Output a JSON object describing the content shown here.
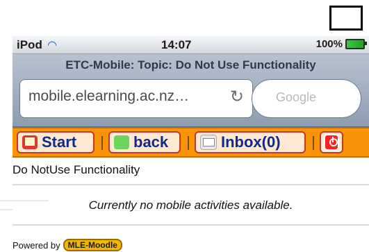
{
  "status_bar": {
    "carrier": "iPod",
    "time": "14:07",
    "battery": "100%"
  },
  "browser": {
    "title": "ETC-Mobile: Topic: Do Not Use Functionality",
    "url": "mobile.elearning.ac.nz…",
    "search_placeholder": "Google"
  },
  "nav": {
    "start_label": "Start",
    "back_label": "back",
    "inbox_label": "Inbox(0)"
  },
  "content": {
    "heading": "Do NotUse Functionality",
    "empty_message": "Currently no mobile activities available."
  },
  "footer": {
    "powered_by": "Powered by",
    "badge": "MLE-Moodle"
  },
  "colors": {
    "accent": "#f89406",
    "nav_text": "#0f2a8a"
  }
}
